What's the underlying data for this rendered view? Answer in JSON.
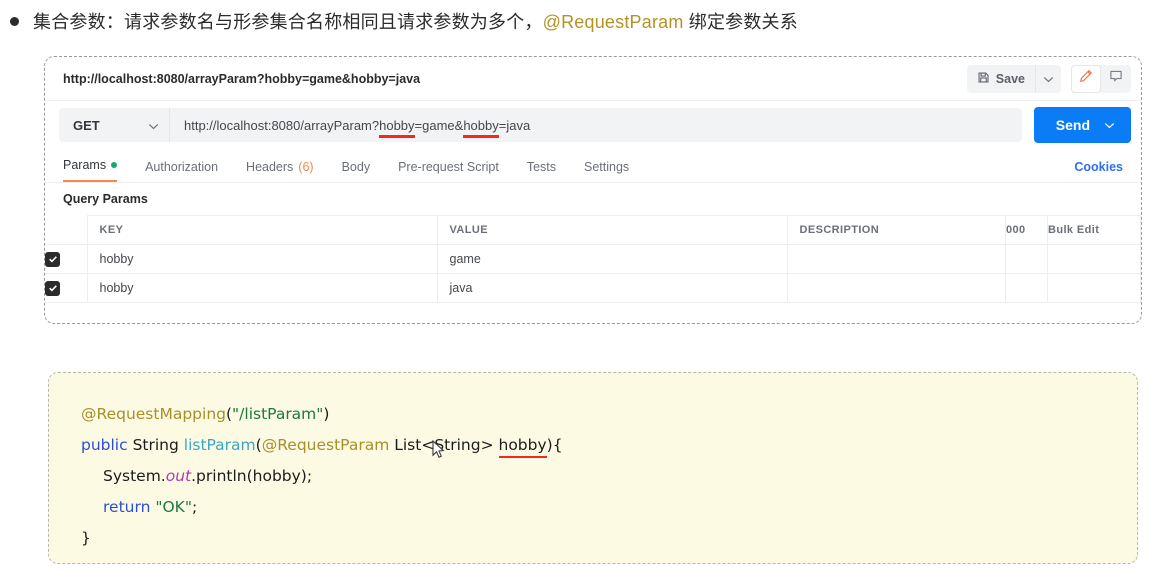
{
  "heading": {
    "bullet": "bullet-dot",
    "text_before": "集合参数：请求参数名与形参集合名称相同且请求参数为多个，",
    "annotation": "@RequestParam",
    "text_after": " 绑定参数关系"
  },
  "postman": {
    "request_name": "http://localhost:8080/arrayParam?hobby=game&hobby=java",
    "save_label": "Save",
    "save_caret_icon": "chevron-down-icon",
    "save_icon": "floppy-disk-icon",
    "edit_icon": "pencil-icon",
    "comment_icon": "comment-icon",
    "method": "GET",
    "method_caret_icon": "chevron-down-icon",
    "url": {
      "p1": "http://localhost:8080/arrayParam?",
      "u1": "hobby",
      "p2": "=game&",
      "u2": "hobby",
      "p3": "=java"
    },
    "send_label": "Send",
    "send_caret_icon": "chevron-down-icon",
    "tabs": [
      {
        "label": "Params",
        "active": true,
        "dot": true,
        "count": ""
      },
      {
        "label": "Authorization",
        "active": false,
        "dot": false,
        "count": ""
      },
      {
        "label": "Headers",
        "active": false,
        "dot": false,
        "count": "(6)"
      },
      {
        "label": "Body",
        "active": false,
        "dot": false,
        "count": ""
      },
      {
        "label": "Pre-request Script",
        "active": false,
        "dot": false,
        "count": ""
      },
      {
        "label": "Tests",
        "active": false,
        "dot": false,
        "count": ""
      },
      {
        "label": "Settings",
        "active": false,
        "dot": false,
        "count": ""
      }
    ],
    "cookies_link": "Cookies",
    "query_params_label": "Query Params",
    "table": {
      "headers": {
        "key": "KEY",
        "value": "VALUE",
        "description": "DESCRIPTION",
        "dots": "000",
        "bulk_edit": "Bulk Edit"
      },
      "rows": [
        {
          "checked": true,
          "key": "hobby",
          "value": "game",
          "description": ""
        },
        {
          "checked": true,
          "key": "hobby",
          "value": "java",
          "description": ""
        }
      ]
    }
  },
  "code": {
    "line1": {
      "anno": "@RequestMapping",
      "paren_open": "(",
      "str": "\"/listParam\"",
      "paren_close": ")"
    },
    "line2": {
      "kw": "public",
      "type": " String ",
      "method": "listParam",
      "paren": "(",
      "anno": "@RequestParam",
      "generic": " List<String> ",
      "param": "hobby",
      "tail": "){"
    },
    "line3": {
      "a": "System.",
      "field": "out",
      "b": ".println(hobby);"
    },
    "line4": {
      "kw": "return",
      "str": " \"OK\"",
      "semi": ";"
    },
    "line5": "}"
  },
  "colors": {
    "accent_blue": "#0a7cf5",
    "tab_underline": "#f08a4b",
    "green_dot": "#0cae6a",
    "annotation_gold": "#b39327",
    "underline_red": "#f22a1d",
    "code_bg": "#fdfae4"
  }
}
